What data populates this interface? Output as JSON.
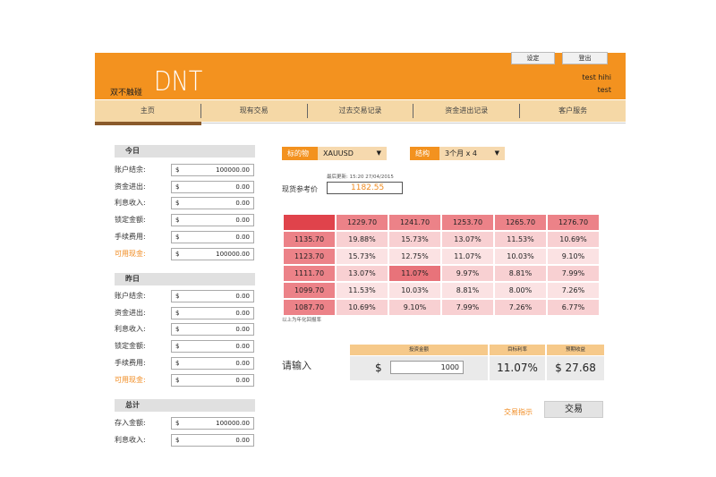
{
  "header": {
    "brand_small": "双不触碰",
    "brand_logo": "DNT",
    "settings_label": "设定",
    "logout_label": "登出",
    "user_line1": "test hihi",
    "user_line2": "test"
  },
  "nav": {
    "items": [
      "主页",
      "现有交易",
      "过去交易记录",
      "资金进出记录",
      "客户服务"
    ]
  },
  "today": {
    "title": "今日",
    "rows": [
      {
        "label": "账户结余:",
        "currency": "$",
        "amount": "100000.00"
      },
      {
        "label": "资金进出:",
        "currency": "$",
        "amount": "0.00"
      },
      {
        "label": "利息收入:",
        "currency": "$",
        "amount": "0.00"
      },
      {
        "label": "锁定金额:",
        "currency": "$",
        "amount": "0.00"
      },
      {
        "label": "手续费用:",
        "currency": "$",
        "amount": "0.00"
      },
      {
        "label": "可用现金:",
        "currency": "$",
        "amount": "100000.00"
      }
    ]
  },
  "yesterday": {
    "title": "昨日",
    "rows": [
      {
        "label": "账户结余:",
        "currency": "$",
        "amount": "0.00"
      },
      {
        "label": "资金进出:",
        "currency": "$",
        "amount": "0.00"
      },
      {
        "label": "利息收入:",
        "currency": "$",
        "amount": "0.00"
      },
      {
        "label": "锁定金额:",
        "currency": "$",
        "amount": "0.00"
      },
      {
        "label": "手续费用:",
        "currency": "$",
        "amount": "0.00"
      },
      {
        "label": "可用现金:",
        "currency": "$",
        "amount": "0.00"
      }
    ]
  },
  "total": {
    "title": "总计",
    "rows": [
      {
        "label": "存入金额:",
        "currency": "$",
        "amount": "100000.00"
      },
      {
        "label": "利息收入:",
        "currency": "$",
        "amount": "0.00"
      }
    ]
  },
  "selectors": {
    "underlying_label": "标的物",
    "underlying_value": "XAUUSD",
    "structure_label": "结构",
    "structure_value": "3个月 x 4",
    "caret": "▼"
  },
  "reference": {
    "timestamp": "最后更新: 15:20 27/04/2015",
    "label": "现货参考价",
    "value": "1182.55"
  },
  "matrix": {
    "col_headers": [
      "1229.70",
      "1241.70",
      "1253.70",
      "1265.70",
      "1276.70"
    ],
    "rows": [
      {
        "header": "1135.70",
        "cells": [
          "19.88%",
          "15.73%",
          "13.07%",
          "11.53%",
          "10.69%"
        ]
      },
      {
        "header": "1123.70",
        "cells": [
          "15.73%",
          "12.75%",
          "11.07%",
          "10.03%",
          "9.10%"
        ]
      },
      {
        "header": "1111.70",
        "cells": [
          "13.07%",
          "11.07%",
          "9.97%",
          "8.81%",
          "7.99%"
        ]
      },
      {
        "header": "1099.70",
        "cells": [
          "11.53%",
          "10.03%",
          "8.81%",
          "8.00%",
          "7.26%"
        ]
      },
      {
        "header": "1087.70",
        "cells": [
          "10.69%",
          "9.10%",
          "7.99%",
          "7.26%",
          "6.77%"
        ]
      }
    ],
    "note": "以上为年化回报率",
    "highlight_color": "#e8737a"
  },
  "order": {
    "prompt": "请输入",
    "headers": [
      "投资金额",
      "目标利率",
      "预期收益"
    ],
    "currency": "$",
    "amount": "1000",
    "rate": "11.07%",
    "expected": "$ 27.68",
    "guide_label": "交易指示",
    "trade_label": "交易"
  }
}
